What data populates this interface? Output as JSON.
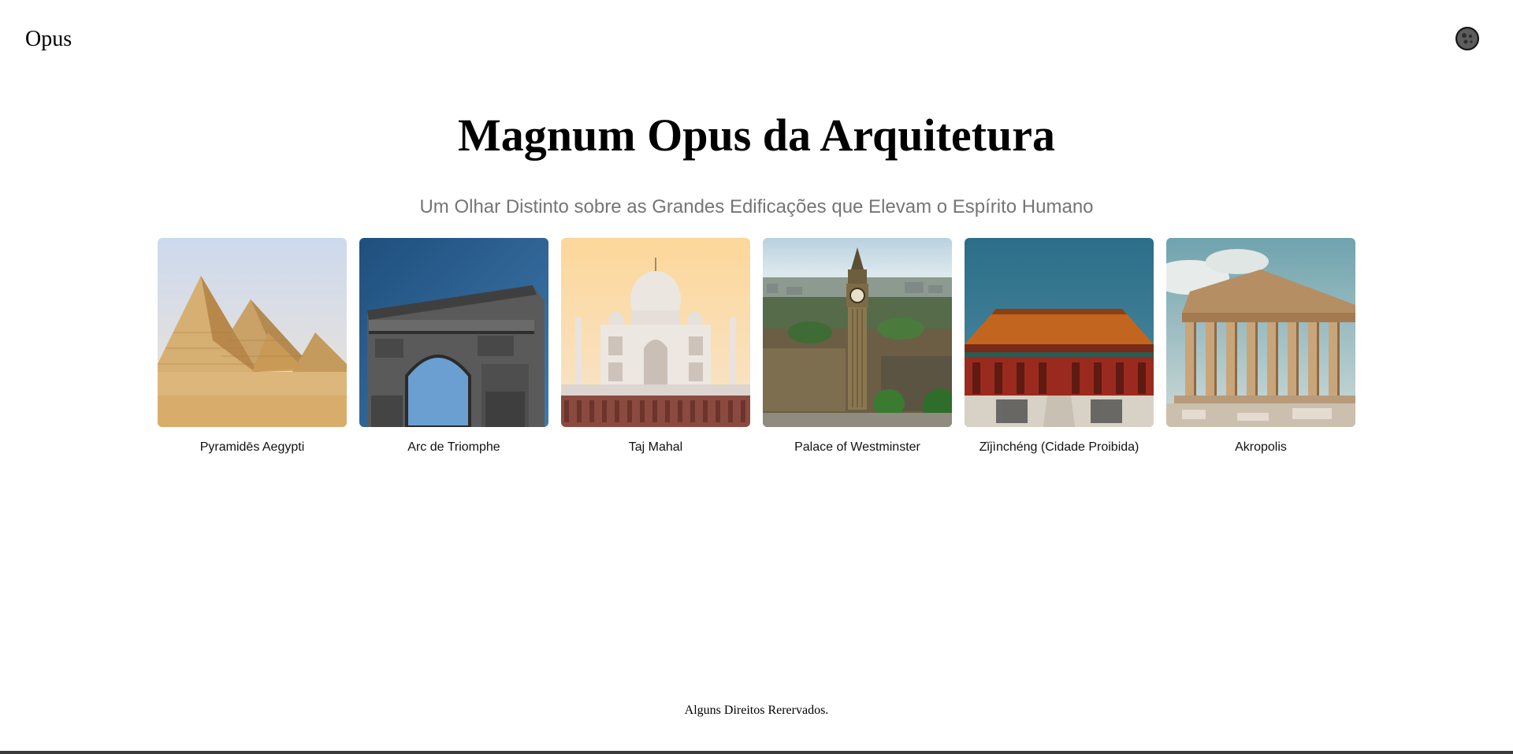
{
  "header": {
    "logo": "Opus",
    "theme_toggle_icon": "moon-icon"
  },
  "hero": {
    "title": "Magnum Opus da Arquitetura",
    "subtitle": "Um Olhar Distinto sobre as Grandes Edificações que Elevam o Espírito Humano"
  },
  "gallery": {
    "items": [
      {
        "label": "Pyramidēs Aegypti"
      },
      {
        "label": "Arc de Triomphe"
      },
      {
        "label": "Taj Mahal"
      },
      {
        "label": "Palace of Westminster"
      },
      {
        "label": "Zǐjìnchéng (Cidade Proibida)"
      },
      {
        "label": "Akropolis"
      }
    ]
  },
  "footer": {
    "text": "Alguns Direitos Rerervados."
  },
  "colors": {
    "subtitle": "#757575",
    "background": "#ffffff"
  }
}
